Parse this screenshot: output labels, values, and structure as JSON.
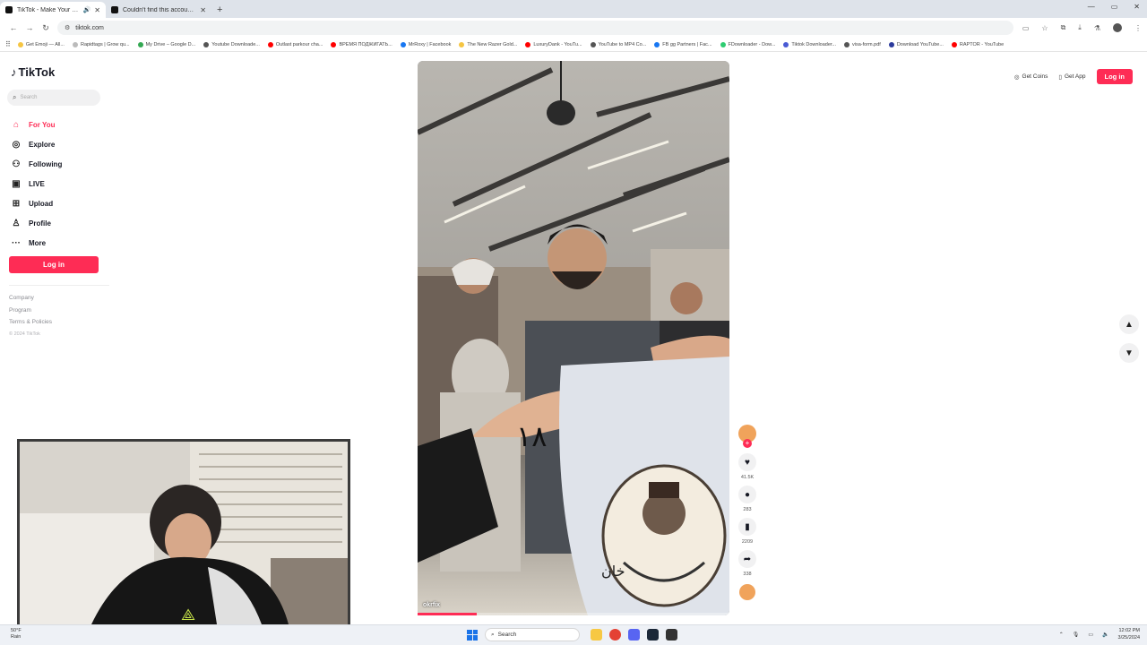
{
  "browser": {
    "tabs": [
      {
        "title": "TikTok - Make Your Day",
        "active": true,
        "audio": true
      },
      {
        "title": "Couldn't find this account. Visit",
        "active": false,
        "audio": false
      }
    ],
    "url": "tiktok.com",
    "bookmarks": [
      {
        "label": "Get Emoji — All...",
        "color": "#f5c542"
      },
      {
        "label": "Rapidtags | Grow qu...",
        "color": "#bbbbbb"
      },
      {
        "label": "My Drive – Google D...",
        "color": "#34a853"
      },
      {
        "label": "Youtube Downloade...",
        "color": "#555555"
      },
      {
        "label": "Outlast parkour cha...",
        "color": "#ff0000"
      },
      {
        "label": "ВРЕМЯ ПОДЖИГАТЬ...",
        "color": "#ff0000"
      },
      {
        "label": "MrRoxy | Facebook",
        "color": "#1877f2"
      },
      {
        "label": "The New Razer Gold...",
        "color": "#f5c542"
      },
      {
        "label": "LuxuryDank - YouTu...",
        "color": "#ff0000"
      },
      {
        "label": "YouTube to MP4 Co...",
        "color": "#555555"
      },
      {
        "label": "FB gg Partners | Fac...",
        "color": "#1877f2"
      },
      {
        "label": "FDownloader - Dow...",
        "color": "#2ecc71"
      },
      {
        "label": "Tiktok Downloader...",
        "color": "#4a5bd4"
      },
      {
        "label": "visa-form.pdf",
        "color": "#555555"
      },
      {
        "label": "Download YouTube...",
        "color": "#2b3a9c"
      },
      {
        "label": "RAPTOR - YouTube",
        "color": "#ff0000"
      }
    ]
  },
  "tiktok": {
    "logo": "TikTok",
    "search_placeholder": "Search",
    "nav": [
      {
        "label": "For You",
        "icon": "home-icon",
        "glyph": "⌂",
        "active": true
      },
      {
        "label": "Explore",
        "icon": "compass-icon",
        "glyph": "◎",
        "active": false
      },
      {
        "label": "Following",
        "icon": "following-icon",
        "glyph": "⚇",
        "active": false
      },
      {
        "label": "LIVE",
        "icon": "live-icon",
        "glyph": "▣",
        "active": false
      },
      {
        "label": "Upload",
        "icon": "upload-icon",
        "glyph": "⊞",
        "active": false
      },
      {
        "label": "Profile",
        "icon": "profile-icon",
        "glyph": "♙",
        "active": false
      },
      {
        "label": "More",
        "icon": "more-icon",
        "glyph": "···",
        "active": false
      }
    ],
    "login_label": "Log in",
    "footer_links": [
      "Company",
      "Program",
      "Terms & Policies"
    ],
    "copyright": "© 2024 TikTok",
    "top_links": {
      "coins": "Get Coins",
      "app": "Get App",
      "login": "Log in"
    },
    "video": {
      "watermark": "okrfix",
      "progress": 0.19
    },
    "actions": {
      "likes": "41.5K",
      "comments": "283",
      "saves": "2209",
      "shares": "338"
    }
  },
  "taskbar": {
    "weather_temp": "50°F",
    "weather_cond": "Rain",
    "search_label": "Search",
    "time": "12:02 PM",
    "date": "3/25/2024"
  }
}
